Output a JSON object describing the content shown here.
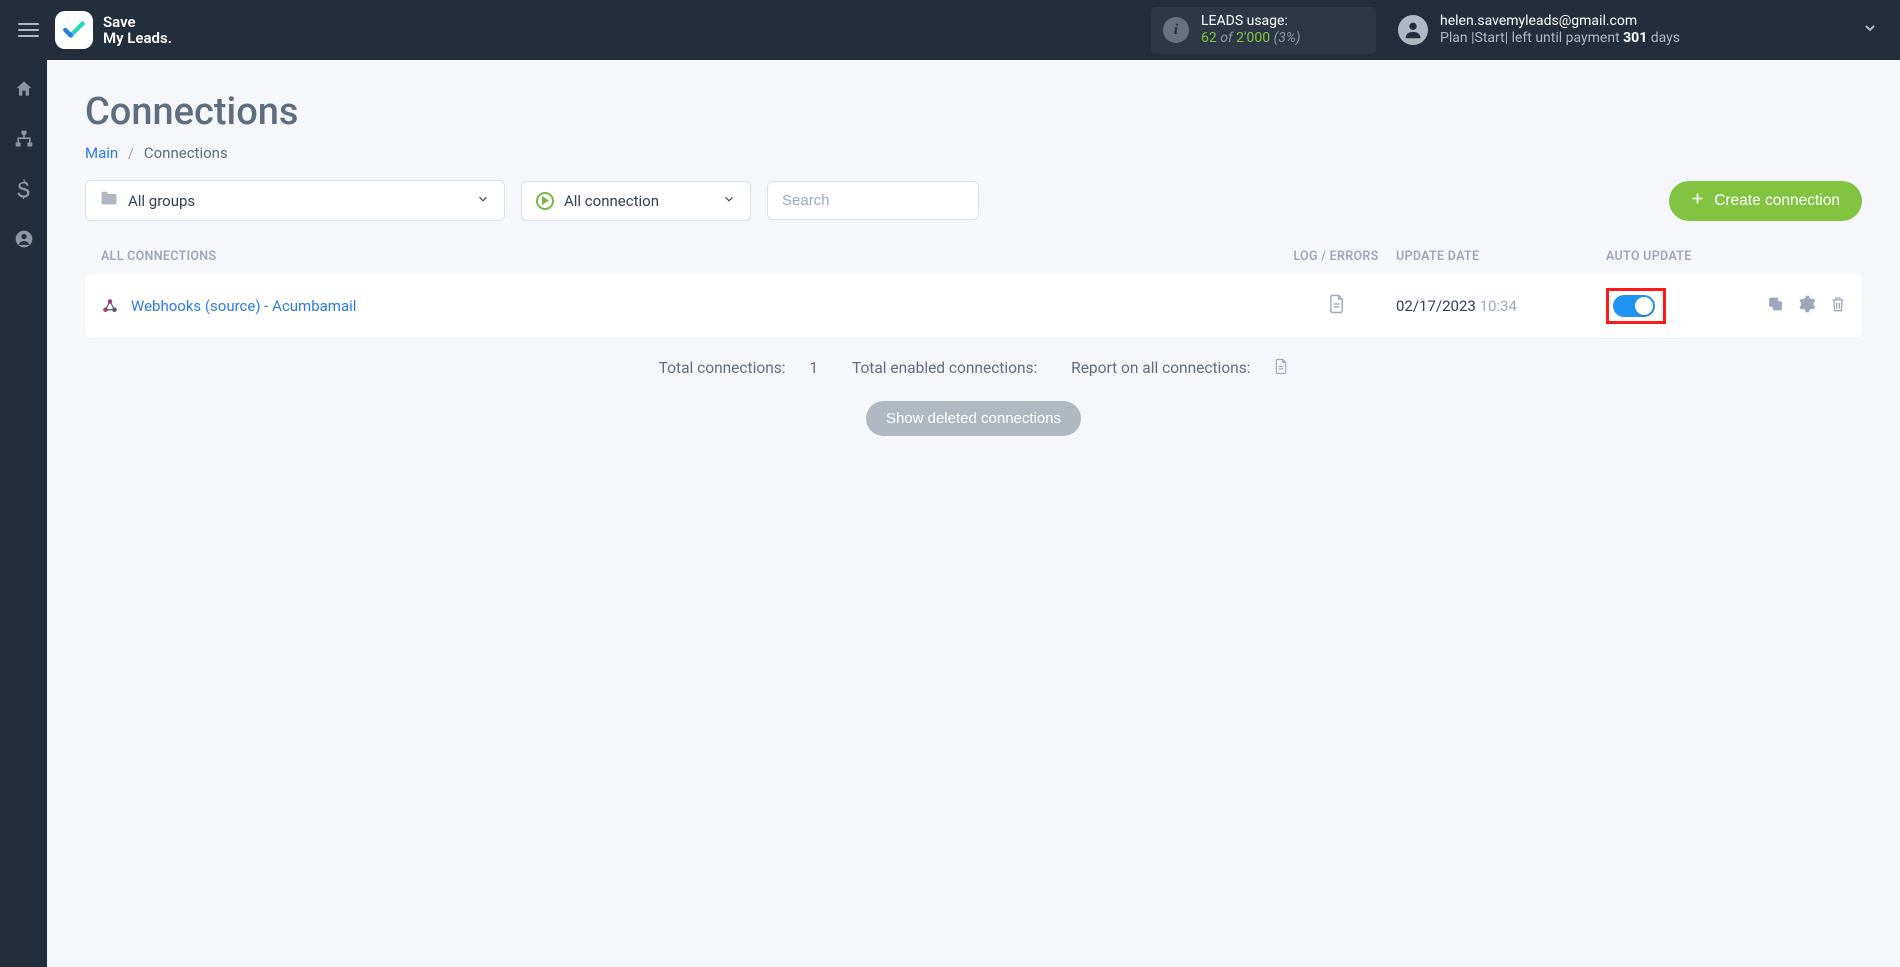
{
  "header": {
    "logo_line1": "Save",
    "logo_line2": "My Leads.",
    "usage": {
      "label": "LEADS usage:",
      "used": "62",
      "of_word": "of",
      "total": "2'000",
      "percent": "(3%)"
    },
    "account": {
      "email": "helen.savemyleads@gmail.com",
      "plan_prefix": "Plan |",
      "plan_name": "Start",
      "plan_middle": "| left until payment",
      "days": "301",
      "days_label": "days"
    }
  },
  "page": {
    "title": "Connections",
    "breadcrumb_main": "Main",
    "breadcrumb_current": "Connections"
  },
  "filters": {
    "groups_label": "All groups",
    "connection_label": "All connection",
    "search_placeholder": "Search",
    "create_label": "Create connection"
  },
  "table": {
    "header": {
      "all_connections": "ALL CONNECTIONS",
      "log_errors": "LOG / ERRORS",
      "update_date": "UPDATE DATE",
      "auto_update": "AUTO UPDATE"
    },
    "rows": [
      {
        "name": "Webhooks (source) - Acumbamail",
        "date": "02/17/2023",
        "time": "10:34"
      }
    ]
  },
  "stats": {
    "total_conn_label": "Total connections:",
    "total_conn_value": "1",
    "total_enabled_label": "Total enabled connections:",
    "report_label": "Report on all connections:"
  },
  "buttons": {
    "show_deleted": "Show deleted connections"
  }
}
